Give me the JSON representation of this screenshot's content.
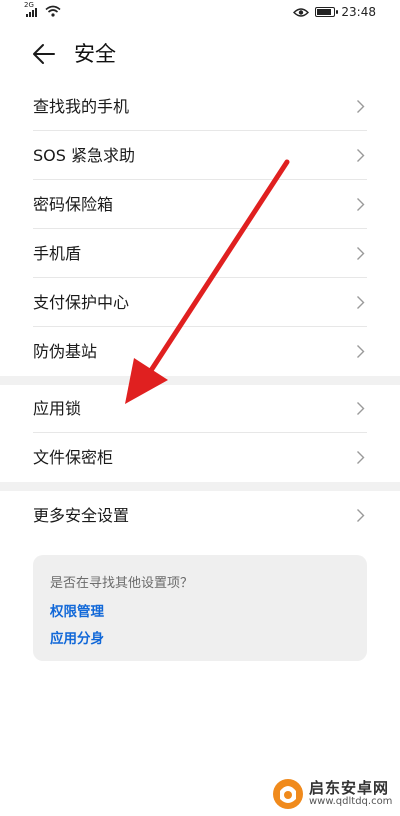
{
  "status_bar": {
    "network_label": "2G",
    "time": "23:48",
    "signal_icon": "cellular-signal-icon",
    "wifi_icon": "wifi-icon",
    "eye_icon": "eye-comfort-icon",
    "battery_level": 0.9
  },
  "header": {
    "back_icon": "arrow-left-icon",
    "title": "安全"
  },
  "group1": [
    {
      "label": "查找我的手机"
    },
    {
      "label": "SOS 紧急求助"
    },
    {
      "label": "密码保险箱"
    },
    {
      "label": "手机盾"
    },
    {
      "label": "支付保护中心"
    },
    {
      "label": "防伪基站"
    }
  ],
  "group2": [
    {
      "label": "应用锁"
    },
    {
      "label": "文件保密柜"
    }
  ],
  "group3": [
    {
      "label": "更多安全设置"
    }
  ],
  "suggestions": {
    "question": "是否在寻找其他设置项？",
    "links": [
      "权限管理",
      "应用分身"
    ]
  },
  "annotation": {
    "color": "#e02020"
  },
  "watermark": {
    "name": "启东安卓网",
    "url": "www.qdltdq.com"
  },
  "colors": {
    "link": "#1168d8",
    "divider": "#e7e7e7",
    "section_gap": "#f1f1f1"
  }
}
